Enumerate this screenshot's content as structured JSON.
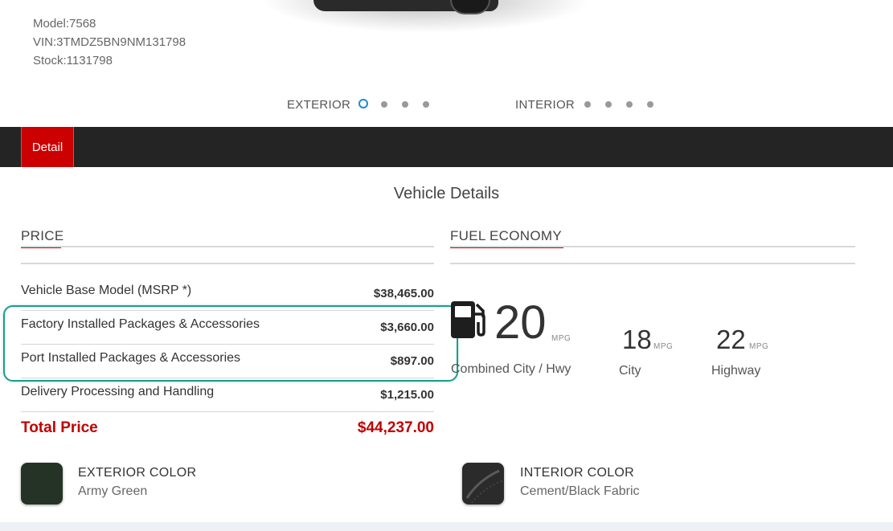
{
  "vehicle": {
    "model": "Model:7568",
    "vin": "VIN:3TMDZ5BN9NM131798",
    "stock": "Stock:1131798"
  },
  "carousel": {
    "exterior_label": "EXTERIOR",
    "interior_label": "INTERIOR",
    "exterior_dots": 4,
    "interior_dots": 4,
    "active_dot": 0
  },
  "tabs": {
    "detail_label": "Detail"
  },
  "section_title": "Vehicle Details",
  "price": {
    "heading": "PRICE",
    "rows": [
      {
        "label": "Vehicle Base Model (MSRP *)",
        "value": "$38,465.00"
      },
      {
        "label": "Factory Installed Packages & Accessories",
        "value": "$3,660.00"
      },
      {
        "label": "Port Installed Packages & Accessories",
        "value": "$897.00"
      },
      {
        "label": "Delivery Processing and Handling",
        "value": "$1,215.00"
      }
    ],
    "total_label": "Total Price",
    "total_value": "$44,237.00"
  },
  "fuel": {
    "heading": "FUEL ECONOMY",
    "combined_value": "20",
    "combined_unit": "MPG",
    "combined_caption": "Combined City / Hwy",
    "city_value": "18",
    "city_unit": "MPG",
    "city_caption": "City",
    "highway_value": "22",
    "highway_unit": "MPG",
    "highway_caption": "Highway"
  },
  "colors": {
    "exterior_heading": "EXTERIOR COLOR",
    "exterior_name": "Army Green",
    "exterior_hex": "#243326",
    "interior_heading": "INTERIOR COLOR",
    "interior_name": "Cement/Black Fabric",
    "interior_hex": "#2b2b2b"
  },
  "theme": {
    "accent": "#cc0000",
    "highlight": "#1a9e8a",
    "carousel_active": "#1a8ccf"
  }
}
